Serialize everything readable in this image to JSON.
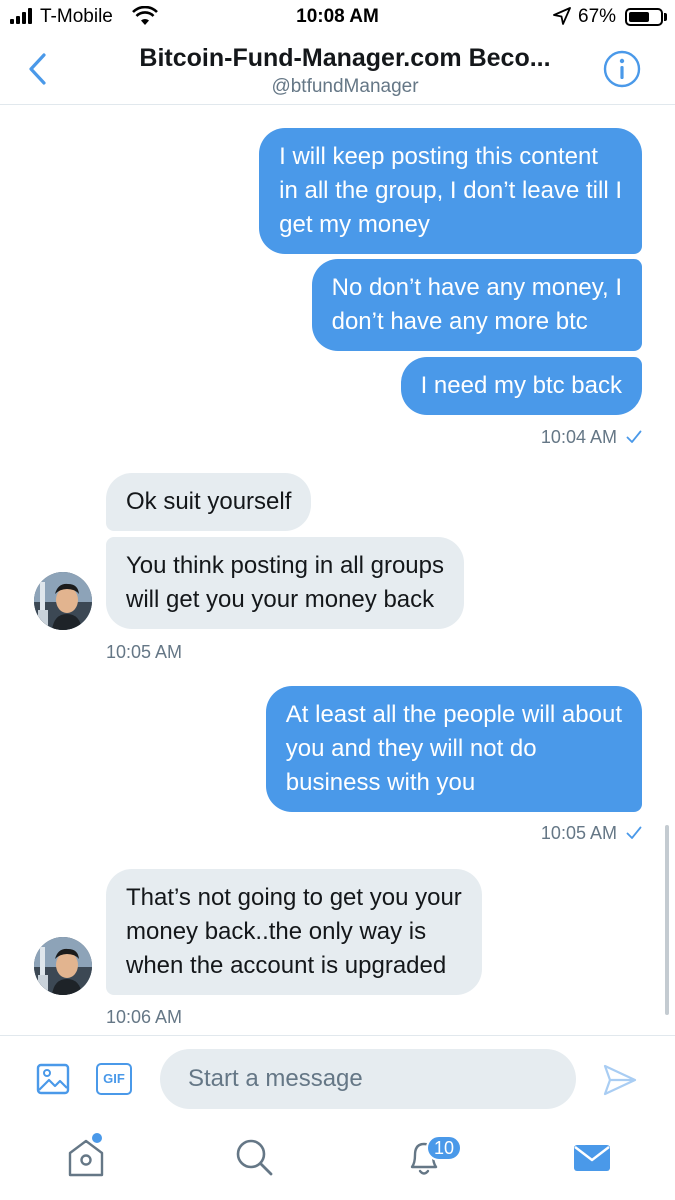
{
  "status_bar": {
    "carrier": "T-Mobile",
    "time": "10:08 AM",
    "battery_percent": "67%",
    "battery_level": 0.67
  },
  "header": {
    "title": "Bitcoin-Fund-Manager.com Beco...",
    "handle": "@btfundManager"
  },
  "messages": [
    {
      "direction": "out",
      "lines": [
        "I will keep posting this content",
        "in all the group, I don’t leave till I",
        "get my money"
      ]
    },
    {
      "direction": "out",
      "lines": [
        "No don’t have any money, I",
        "don’t have any more btc"
      ]
    },
    {
      "direction": "out",
      "lines": [
        "I need my btc back"
      ]
    },
    {
      "meta": "10:04 AM",
      "read": true
    },
    {
      "direction": "in",
      "lines": [
        "Ok suit yourself"
      ]
    },
    {
      "direction": "in",
      "lines": [
        "You think posting in all groups",
        "will get you your money back"
      ]
    },
    {
      "meta": "10:05 AM"
    },
    {
      "direction": "out",
      "lines": [
        "At least all the people will about",
        "you and they will not do",
        "business with you"
      ]
    },
    {
      "meta": "10:05 AM",
      "read": true
    },
    {
      "direction": "in",
      "lines": [
        "That’s not going to get you your",
        "money back..the only way is",
        "when the account is upgraded"
      ]
    },
    {
      "meta": "10:06 AM"
    }
  ],
  "composer": {
    "gif_label": "GIF",
    "placeholder": "Start a message"
  },
  "tab_bar": {
    "notifications_badge": "10"
  },
  "colors": {
    "accent": "#4a99e9",
    "incoming_bubble": "#e6ecf0",
    "secondary_text": "#657786"
  },
  "icons": [
    "back-icon",
    "info-icon",
    "image-icon",
    "send-icon",
    "home-icon",
    "search-icon",
    "bell-icon",
    "mail-icon",
    "wifi-icon",
    "location-icon",
    "checkmark-icon"
  ]
}
